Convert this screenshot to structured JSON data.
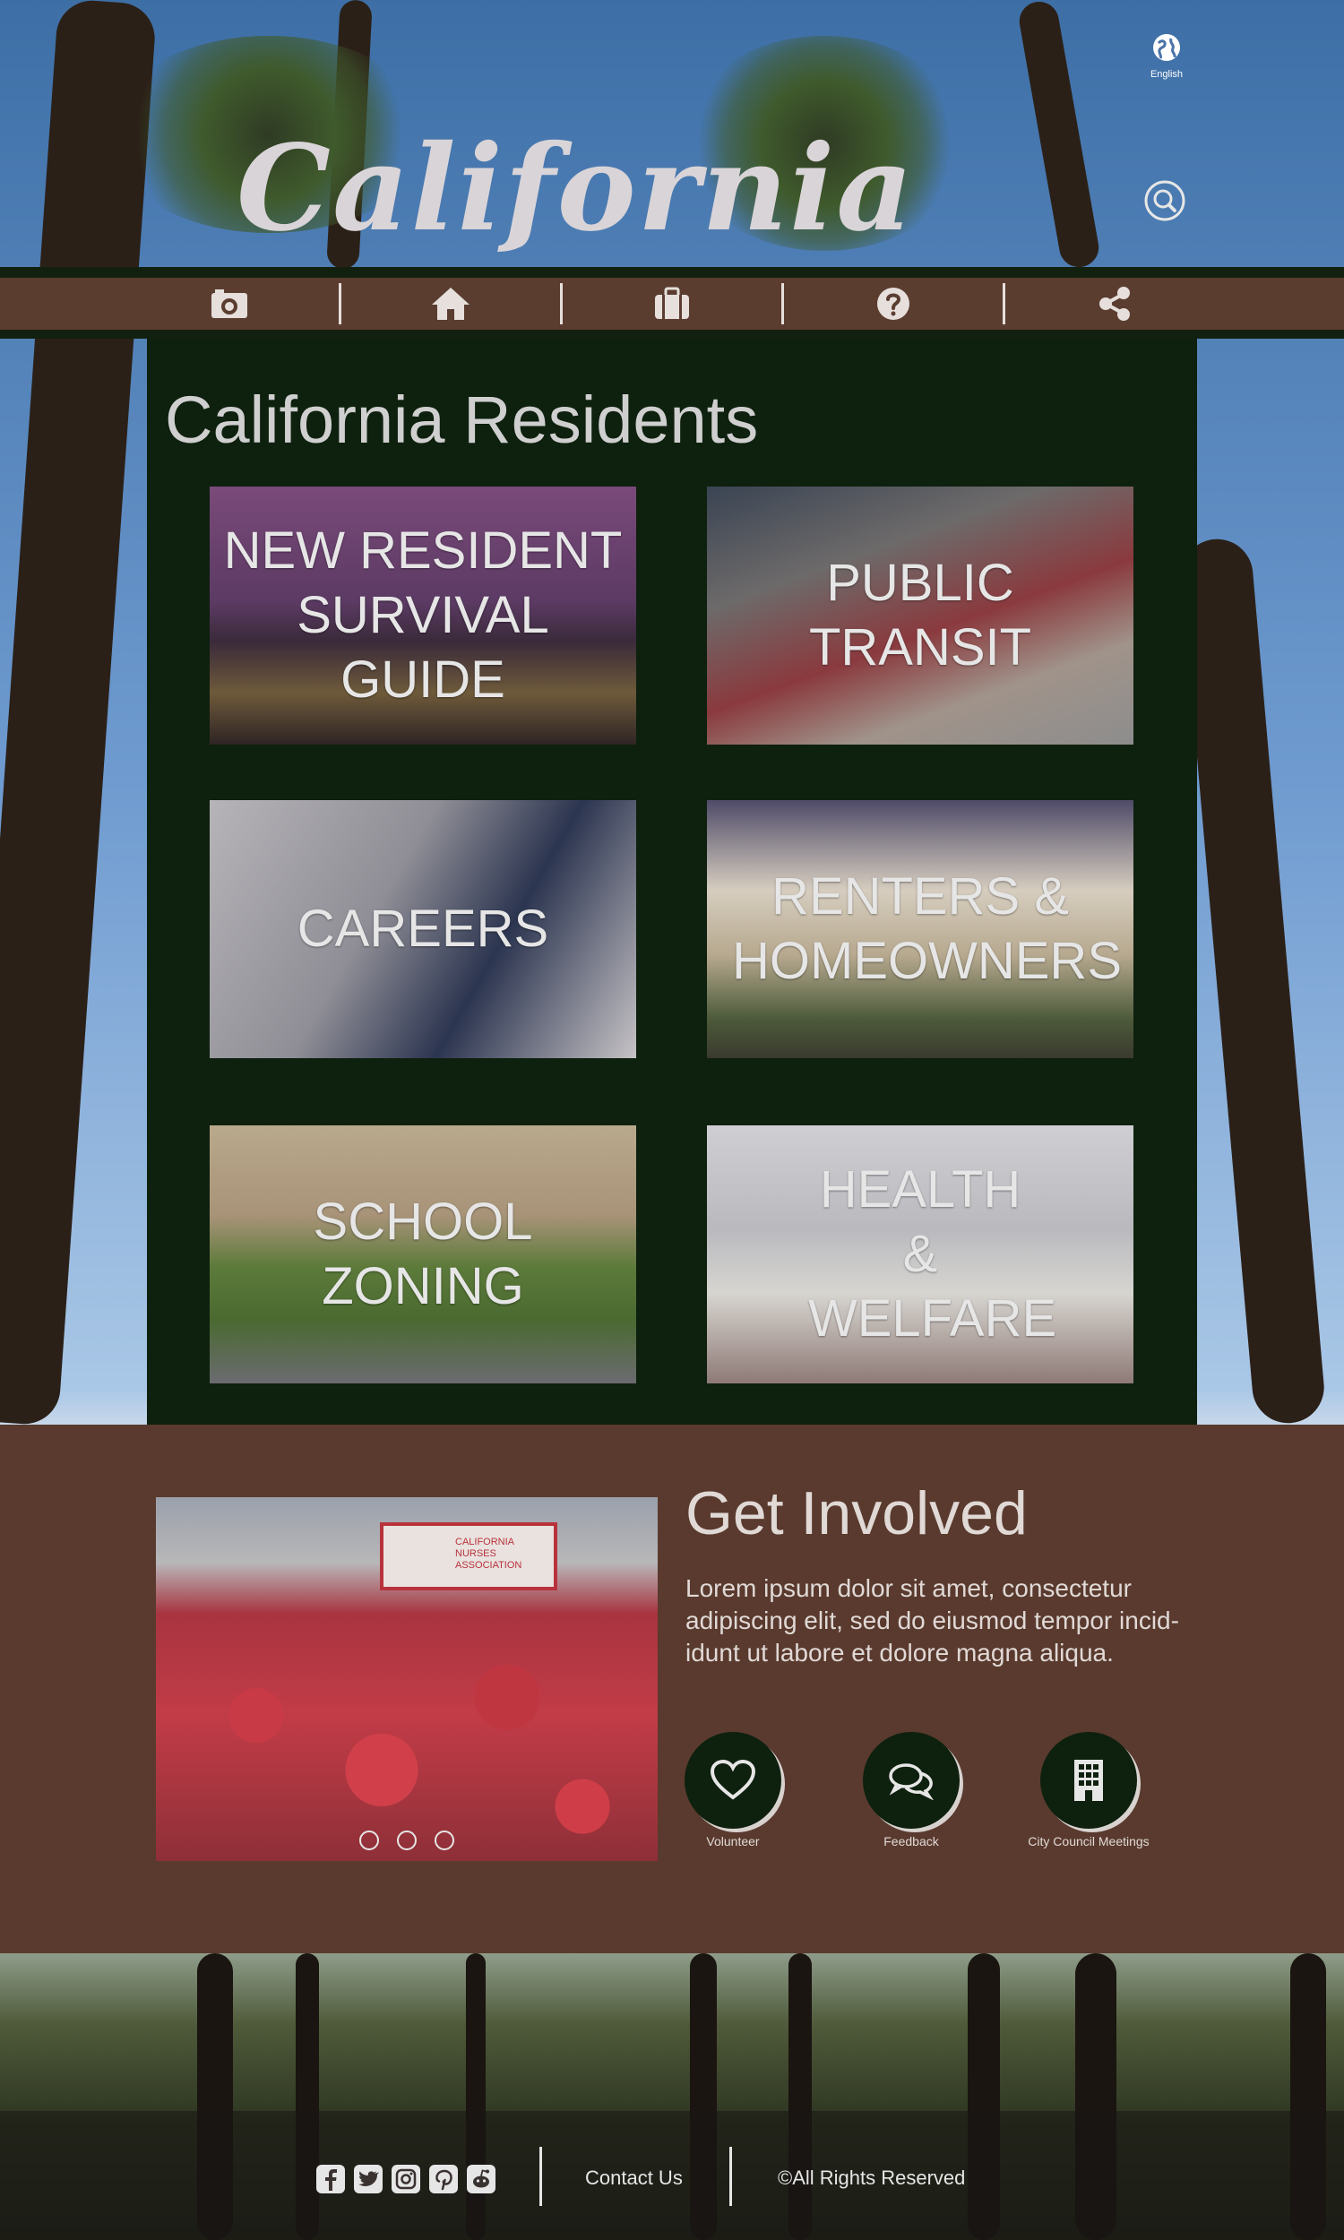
{
  "header": {
    "logo_text": "California",
    "language_label": "English"
  },
  "nav": {
    "items": [
      {
        "icon": "camera-icon"
      },
      {
        "icon": "home-icon"
      },
      {
        "icon": "briefcase-icon"
      },
      {
        "icon": "question-icon"
      },
      {
        "icon": "share-icon"
      }
    ]
  },
  "residents": {
    "title": "California Residents",
    "tiles": [
      {
        "label": "NEW RESIDENT SURVIVAL GUIDE"
      },
      {
        "label": "PUBLIC TRANSIT"
      },
      {
        "label": "CAREERS"
      },
      {
        "label": "RENTERS & HOMEOWNERS"
      },
      {
        "label": "SCHOOL ZONING"
      },
      {
        "label": "HEALTH & WELFARE"
      }
    ]
  },
  "involved": {
    "title": "Get Involved",
    "body": "Lorem ipsum dolor sit amet, consectetur adipiscing elit, sed do eiusmod tempor incid-idunt ut labore et dolore magna aliqua.",
    "banner_text": "CALIFORNIA NURSES ASSOCIATION",
    "actions": [
      {
        "label": "Volunteer",
        "icon": "heart-icon"
      },
      {
        "label": "Feedback",
        "icon": "chat-icon"
      },
      {
        "label": "City Council Meetings",
        "icon": "building-icon"
      }
    ]
  },
  "footer": {
    "social": [
      "facebook-icon",
      "twitter-icon",
      "instagram-icon",
      "pinterest-icon",
      "reddit-icon"
    ],
    "contact_label": "Contact Us",
    "rights_label": "©All Rights Reserved"
  },
  "colors": {
    "brown": "#5a3a2e",
    "dark_green": "#0e200e",
    "text_light": "#e0d9d6"
  }
}
